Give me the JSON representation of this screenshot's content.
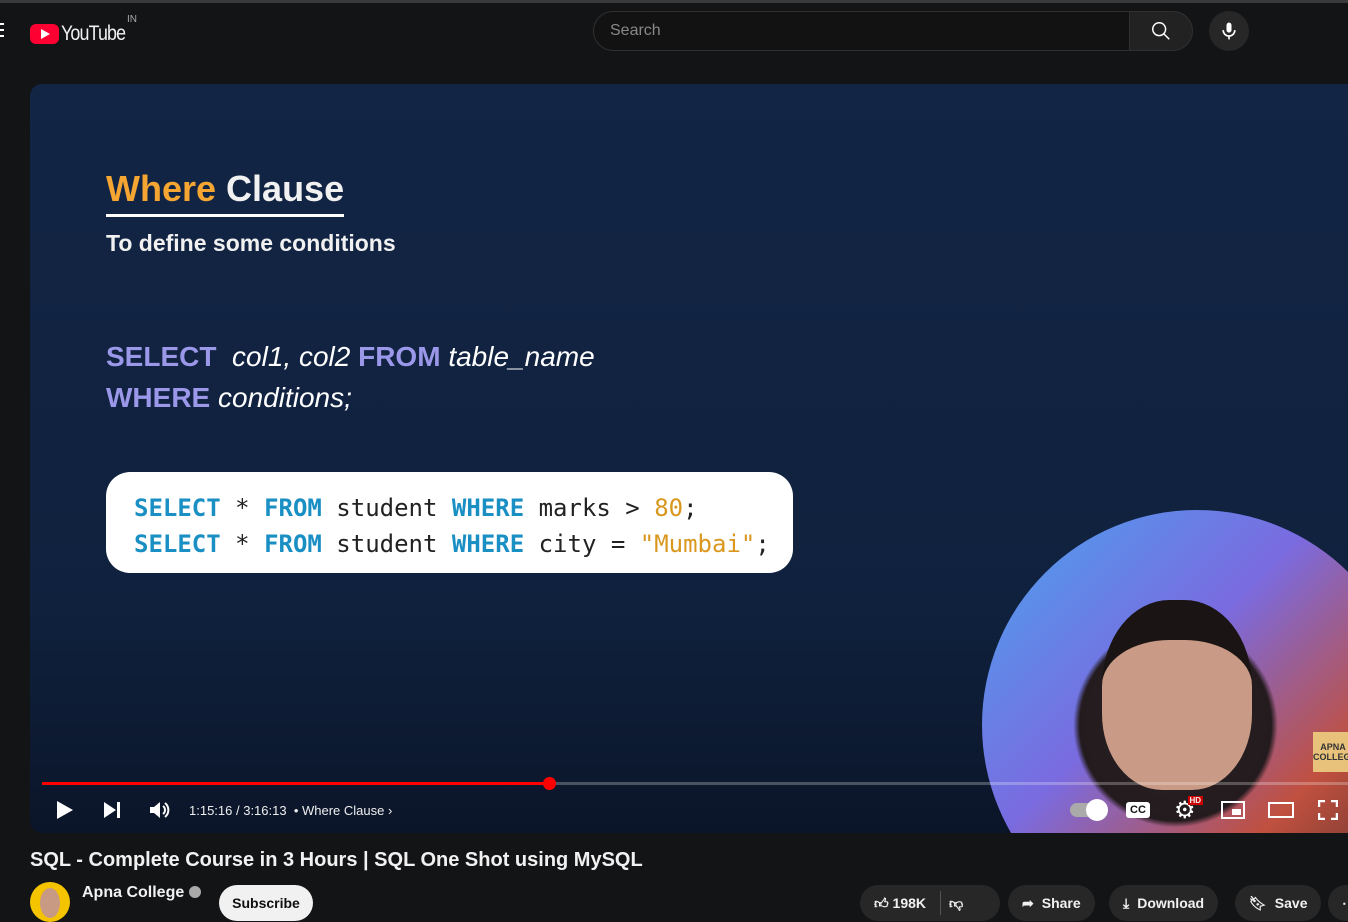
{
  "header": {
    "logo_text": "YouTube",
    "country": "IN",
    "search_placeholder": "Search",
    "search_icon": "magnifier",
    "mic_icon": "microphone"
  },
  "slide": {
    "title_accent": "Where",
    "title_rest": "Clause",
    "subtitle": "To define some conditions",
    "syntax": {
      "kw1": "SELECT",
      "cols": "col1, col2",
      "kw2": "FROM",
      "table": "table_name",
      "kw3": "WHERE",
      "cond": "conditions;"
    },
    "code": [
      {
        "k1": "SELECT",
        "star": " * ",
        "k2": "FROM",
        "t": " student ",
        "k3": "WHERE",
        "c": " marks > ",
        "v": "80",
        "end": ";"
      },
      {
        "k1": "SELECT",
        "star": " * ",
        "k2": "FROM",
        "t": " student ",
        "k3": "WHERE",
        "c": " city = ",
        "v": "\"Mumbai\"",
        "end": ";"
      }
    ],
    "badge": "APNA COLLEGE"
  },
  "player": {
    "progress_fraction": 0.384,
    "current_time": "1:15:16",
    "duration": "3:16:13",
    "time_text": "1:15:16 / 3:16:13",
    "chapter": "Where Clause",
    "hd_badge": "HD",
    "cc_label": "CC",
    "accent": "#ff0000"
  },
  "video": {
    "title": "SQL - Complete Course in 3 Hours | SQL One Shot using MySQL",
    "channel": "Apna College",
    "subscribe": "Subscribe",
    "likes": "198K",
    "share": "Share",
    "download": "Download",
    "save": "Save"
  }
}
